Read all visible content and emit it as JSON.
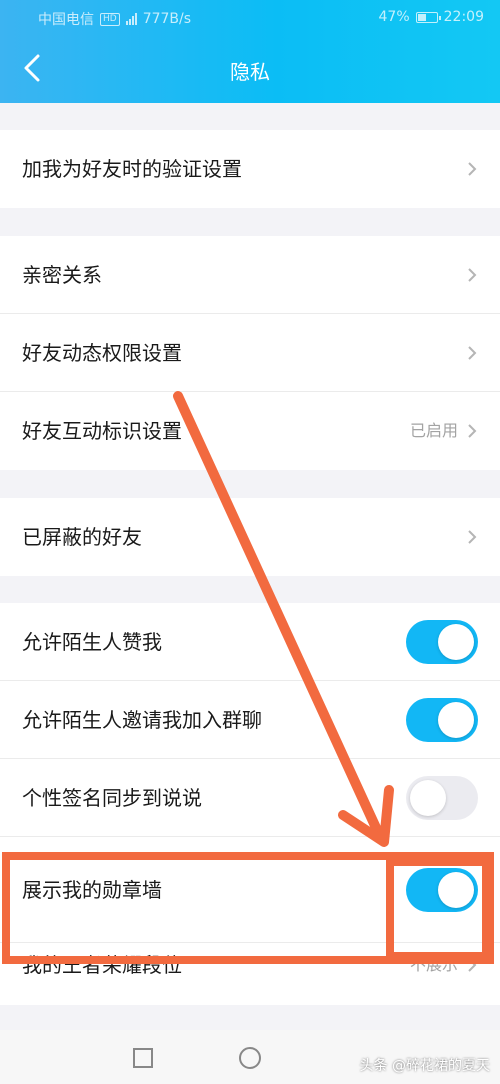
{
  "status_bar": {
    "carrier": "中国电信",
    "hd": "HD",
    "speed": "777B/s",
    "battery": "47%",
    "time": "22:09"
  },
  "header": {
    "title": "隐私"
  },
  "sections": [
    {
      "rows": [
        {
          "label": "加我为好友时的验证设置"
        }
      ]
    },
    {
      "rows": [
        {
          "label": "亲密关系"
        },
        {
          "label": "好友动态权限设置"
        },
        {
          "label": "好友互动标识设置",
          "value": "已启用"
        }
      ]
    },
    {
      "rows": [
        {
          "label": "已屏蔽的好友"
        }
      ]
    },
    {
      "rows": [
        {
          "label": "允许陌生人赞我",
          "toggle": "on"
        },
        {
          "label": "允许陌生人邀请我加入群聊",
          "toggle": "on"
        },
        {
          "label": "个性签名同步到说说",
          "toggle": "off"
        },
        {
          "label": "展示我的勋章墙",
          "toggle": "on"
        },
        {
          "label": "我的王者荣耀段位",
          "value": "不展示"
        }
      ]
    }
  ],
  "watermark": "头条 @碎花裙的夏天",
  "colors": {
    "accent": "#12b7f5",
    "annotation": "#f26a3f"
  }
}
